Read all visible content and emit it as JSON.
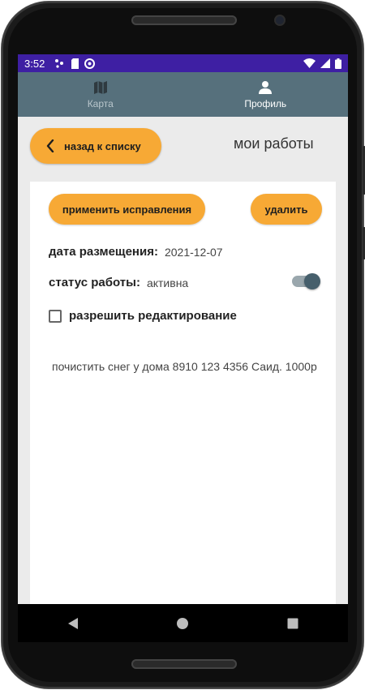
{
  "status_bar": {
    "time": "3:52"
  },
  "bottom_nav": {
    "items": [
      {
        "label": "Карта",
        "icon": "map-icon",
        "active": false
      },
      {
        "label": "Профиль",
        "icon": "person-icon",
        "active": true
      }
    ]
  },
  "header": {
    "back_label": "назад к списку",
    "title": "мои работы"
  },
  "card": {
    "apply_label": "применить исправления",
    "delete_label": "удалить",
    "date_label": "дата размещения:",
    "date_value": "2021-12-07",
    "status_label": "статус работы:",
    "status_value": "активна",
    "status_toggle_on": true,
    "edit_checkbox_label": "разрешить редактирование",
    "edit_checkbox_checked": false,
    "description": "почистить снег у дома 8910 123 4356 Саид. 1000р"
  },
  "colors": {
    "accent": "#f7a935",
    "nav_bg": "#56707c",
    "status_bar": "#3e1fa3"
  }
}
